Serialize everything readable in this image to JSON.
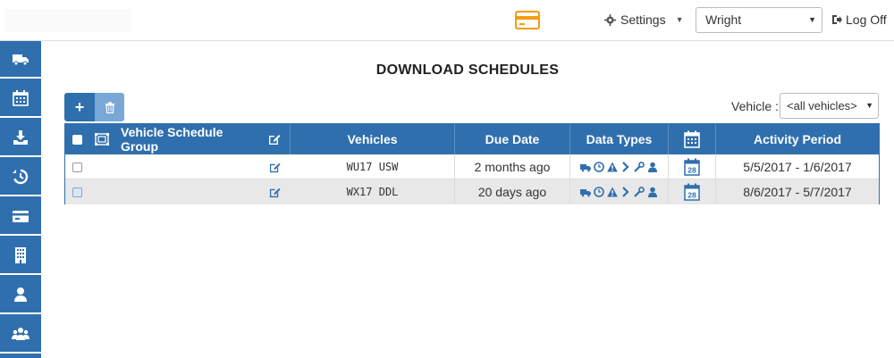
{
  "header": {
    "settings_label": "Settings",
    "user_selected": "Wright",
    "logoff_label": "Log Off"
  },
  "colors": {
    "primary": "#2f6fad",
    "accent": "#f39c12"
  },
  "sidebar": {
    "items": [
      {
        "icon": "truck-icon"
      },
      {
        "icon": "calendar-icon"
      },
      {
        "icon": "download-icon"
      },
      {
        "icon": "history-icon"
      },
      {
        "icon": "card-icon"
      },
      {
        "icon": "building-icon"
      },
      {
        "icon": "user-icon"
      },
      {
        "icon": "users-icon"
      }
    ]
  },
  "main": {
    "title": "DOWNLOAD SCHEDULES",
    "add_button": "+",
    "vehicle_label": "Vehicle :",
    "vehicle_selected": "<all vehicles>"
  },
  "table": {
    "columns": {
      "group": "Vehicle Schedule Group",
      "vehicles": "Vehicles",
      "due_date": "Due Date",
      "data_types": "Data Types",
      "activity_period": "Activity Period"
    },
    "calendar_day": "28",
    "rows": [
      {
        "vehicles": "WU17 USW",
        "due_date": "2 months ago",
        "activity_period": "5/5/2017 - 1/6/2017"
      },
      {
        "vehicles": "WX17 DDL",
        "due_date": "20 days ago",
        "activity_period": "8/6/2017 - 5/7/2017"
      }
    ]
  }
}
